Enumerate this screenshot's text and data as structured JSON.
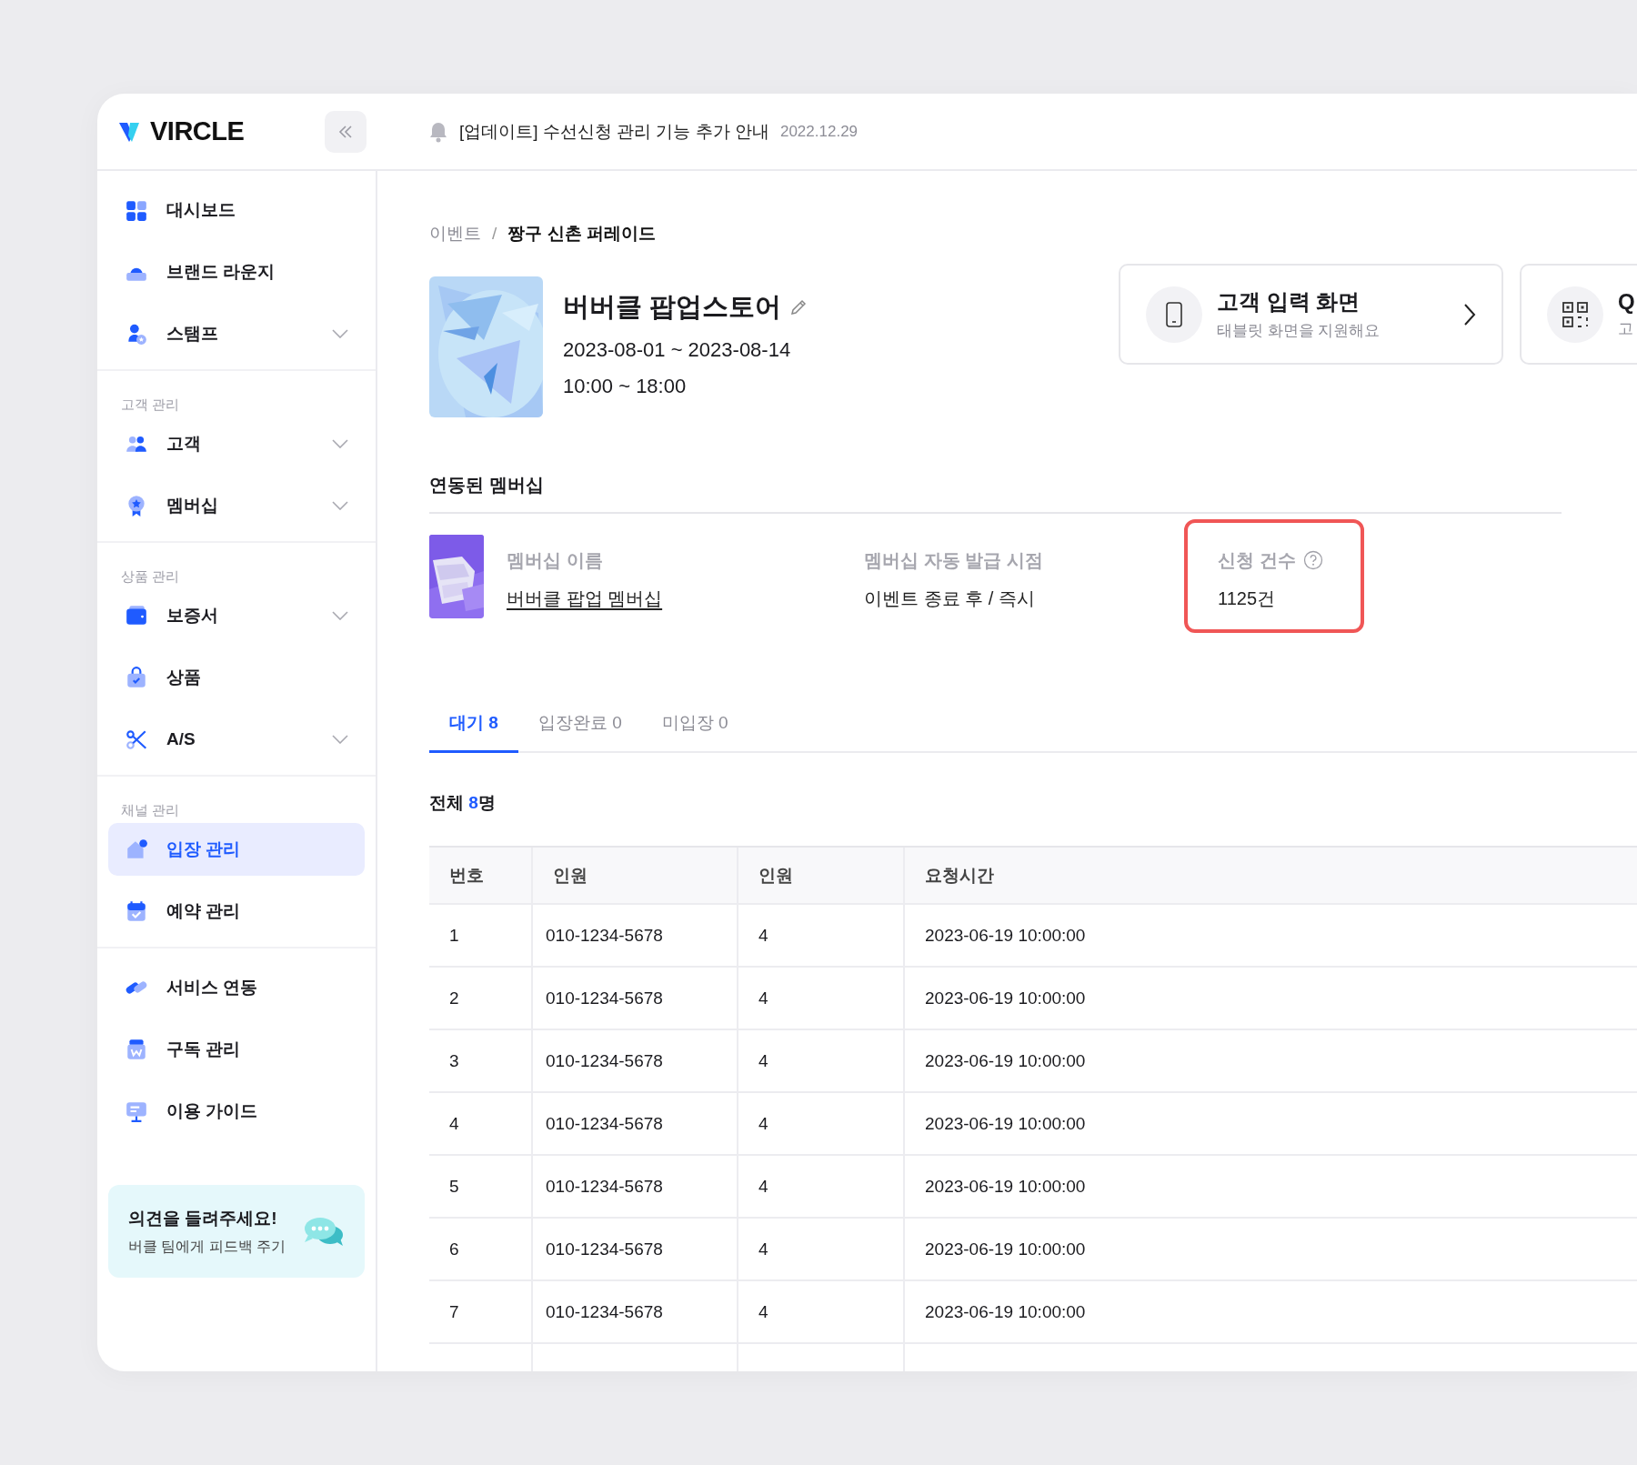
{
  "logo": {
    "text": "VIRCLE"
  },
  "notice": {
    "text": "[업데이트] 수선신청 관리 기능 추가 안내",
    "date": "2022.12.29"
  },
  "sidebar": {
    "groups": [
      {
        "items": [
          {
            "label": "대시보드",
            "expandable": false,
            "selected": false
          },
          {
            "label": "브랜드 라운지",
            "expandable": false,
            "selected": false
          },
          {
            "label": "스탬프",
            "expandable": true,
            "selected": false
          }
        ]
      },
      {
        "label": "고객 관리",
        "items": [
          {
            "label": "고객",
            "expandable": true,
            "selected": false
          },
          {
            "label": "멤버십",
            "expandable": true,
            "selected": false
          }
        ]
      },
      {
        "label": "상품 관리",
        "items": [
          {
            "label": "보증서",
            "expandable": true,
            "selected": false
          },
          {
            "label": "상품",
            "expandable": false,
            "selected": false
          },
          {
            "label": "A/S",
            "expandable": true,
            "selected": false
          }
        ]
      },
      {
        "label": "채널 관리",
        "items": [
          {
            "label": "입장 관리",
            "expandable": false,
            "selected": true
          },
          {
            "label": "예약 관리",
            "expandable": false,
            "selected": false
          }
        ]
      },
      {
        "items": [
          {
            "label": "서비스 연동",
            "expandable": false,
            "selected": false
          },
          {
            "label": "구독 관리",
            "expandable": false,
            "selected": false
          },
          {
            "label": "이용 가이드",
            "expandable": false,
            "selected": false
          }
        ]
      }
    ],
    "feedback": {
      "title": "의견을 들려주세요!",
      "subtitle": "버클 팀에게 피드백 주기"
    }
  },
  "breadcrumb": {
    "separator": "/",
    "items": [
      "이벤트",
      "짱구 신촌 퍼레이드"
    ]
  },
  "event": {
    "title": "버버클 팝업스토어",
    "dates": "2023-08-01 ~ 2023-08-14",
    "hours": "10:00 ~ 18:00"
  },
  "shortcuts": [
    {
      "kind": "tablet",
      "title": "고객 입력 화면",
      "subtitle": "태블릿 화면을 지원해요"
    },
    {
      "kind": "qr",
      "title": "Q",
      "subtitle": "고"
    }
  ],
  "membership": {
    "heading": "연동된 멤버십",
    "fields": [
      {
        "kind": "link",
        "label": "멤버십 이름",
        "value": "버버클 팝업 멤버십",
        "highlighted": false
      },
      {
        "kind": "text",
        "label": "멤버십 자동 발급 시점",
        "value": "이벤트 종료 후 / 즉시",
        "highlighted": false
      },
      {
        "kind": "help",
        "label": "신청 건수",
        "value": "1125건",
        "highlighted": true
      }
    ]
  },
  "tabs": [
    {
      "label": "대기 8",
      "selected": true
    },
    {
      "label": "입장완료 0",
      "selected": false
    },
    {
      "label": "미입장 0",
      "selected": false
    }
  ],
  "total": {
    "label": "전체",
    "count": "8",
    "unit": "명"
  },
  "table": {
    "columns": [
      "번호",
      "인원",
      "인원",
      "요청시간"
    ],
    "rows": [
      [
        "1",
        "010-1234-5678",
        "4",
        "2023-06-19  10:00:00"
      ],
      [
        "2",
        "010-1234-5678",
        "4",
        "2023-06-19  10:00:00"
      ],
      [
        "3",
        "010-1234-5678",
        "4",
        "2023-06-19  10:00:00"
      ],
      [
        "4",
        "010-1234-5678",
        "4",
        "2023-06-19  10:00:00"
      ],
      [
        "5",
        "010-1234-5678",
        "4",
        "2023-06-19  10:00:00"
      ],
      [
        "6",
        "010-1234-5678",
        "4",
        "2023-06-19  10:00:00"
      ],
      [
        "7",
        "010-1234-5678",
        "4",
        "2023-06-19  10:00:00"
      ]
    ]
  }
}
